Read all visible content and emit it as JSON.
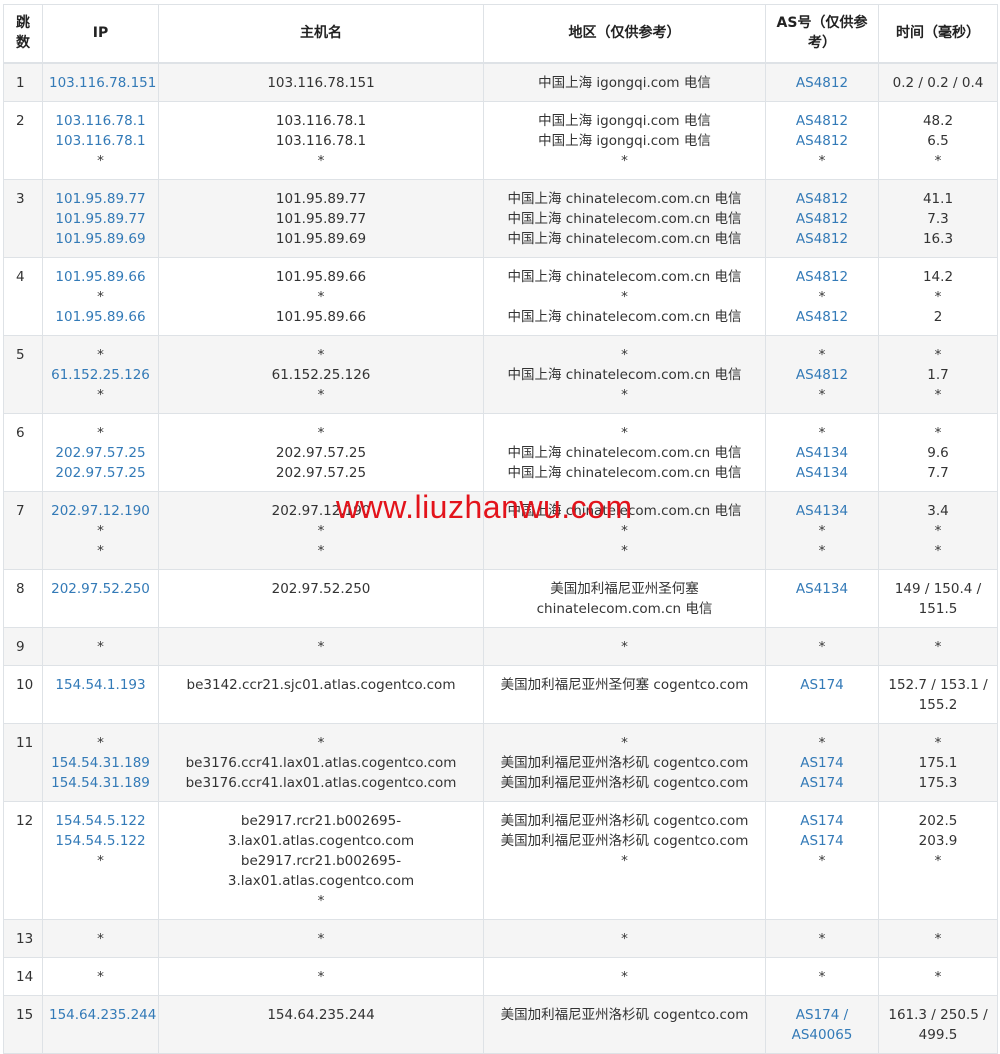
{
  "headers": {
    "hop": "跳数",
    "ip": "IP",
    "host": "主机名",
    "region": "地区（仅供参考）",
    "as": "AS号（仅供参考）",
    "time": "时间（毫秒）"
  },
  "rows": [
    {
      "hop": "1",
      "ips": [
        "103.116.78.151"
      ],
      "hosts": [
        "103.116.78.151"
      ],
      "regions": [
        "中国上海 igongqi.com 电信"
      ],
      "as": [
        "AS4812"
      ],
      "times": [
        "0.2 / 0.2 / 0.4"
      ]
    },
    {
      "hop": "2",
      "ips": [
        "103.116.78.1",
        "103.116.78.1",
        "*"
      ],
      "hosts": [
        "103.116.78.1",
        "103.116.78.1",
        "*"
      ],
      "regions": [
        "中国上海 igongqi.com 电信",
        "中国上海 igongqi.com 电信",
        "*"
      ],
      "as": [
        "AS4812",
        "AS4812",
        "*"
      ],
      "times": [
        "48.2",
        "6.5",
        "*"
      ]
    },
    {
      "hop": "3",
      "ips": [
        "101.95.89.77",
        "101.95.89.77",
        "101.95.89.69"
      ],
      "hosts": [
        "101.95.89.77",
        "101.95.89.77",
        "101.95.89.69"
      ],
      "regions": [
        "中国上海 chinatelecom.com.cn 电信",
        "中国上海 chinatelecom.com.cn 电信",
        "中国上海 chinatelecom.com.cn 电信"
      ],
      "as": [
        "AS4812",
        "AS4812",
        "AS4812"
      ],
      "times": [
        "41.1",
        "7.3",
        "16.3"
      ]
    },
    {
      "hop": "4",
      "ips": [
        "101.95.89.66",
        "*",
        "101.95.89.66"
      ],
      "hosts": [
        "101.95.89.66",
        "*",
        "101.95.89.66"
      ],
      "regions": [
        "中国上海 chinatelecom.com.cn 电信",
        "*",
        "中国上海 chinatelecom.com.cn 电信"
      ],
      "as": [
        "AS4812",
        "*",
        "AS4812"
      ],
      "times": [
        "14.2",
        "*",
        "2"
      ]
    },
    {
      "hop": "5",
      "ips": [
        "*",
        "61.152.25.126",
        "*"
      ],
      "hosts": [
        "*",
        "61.152.25.126",
        "*"
      ],
      "regions": [
        "*",
        "中国上海 chinatelecom.com.cn 电信",
        "*"
      ],
      "as": [
        "*",
        "AS4812",
        "*"
      ],
      "times": [
        "*",
        "1.7",
        "*"
      ]
    },
    {
      "hop": "6",
      "ips": [
        "*",
        "202.97.57.25",
        "202.97.57.25"
      ],
      "hosts": [
        "*",
        "202.97.57.25",
        "202.97.57.25"
      ],
      "regions": [
        "*",
        "中国上海 chinatelecom.com.cn 电信",
        "中国上海 chinatelecom.com.cn 电信"
      ],
      "as": [
        "*",
        "AS4134",
        "AS4134"
      ],
      "times": [
        "*",
        "9.6",
        "7.7"
      ]
    },
    {
      "hop": "7",
      "ips": [
        "202.97.12.190",
        "*",
        "*"
      ],
      "hosts": [
        "202.97.12.190",
        "*",
        "*"
      ],
      "regions": [
        "中国上海 chinatelecom.com.cn 电信",
        "*",
        "*"
      ],
      "as": [
        "AS4134",
        "*",
        "*"
      ],
      "times": [
        "3.4",
        "*",
        "*"
      ]
    },
    {
      "hop": "8",
      "ips": [
        "202.97.52.250"
      ],
      "hosts": [
        "202.97.52.250"
      ],
      "regions": [
        "美国加利福尼亚州圣何塞",
        "chinatelecom.com.cn 电信"
      ],
      "as": [
        "AS4134"
      ],
      "times": [
        "149 / 150.4 /",
        "151.5"
      ]
    },
    {
      "hop": "9",
      "ips": [
        "*"
      ],
      "hosts": [
        "*"
      ],
      "regions": [
        "*"
      ],
      "as": [
        "*"
      ],
      "times": [
        "*"
      ]
    },
    {
      "hop": "10",
      "ips": [
        "154.54.1.193"
      ],
      "hosts": [
        "be3142.ccr21.sjc01.atlas.cogentco.com"
      ],
      "regions": [
        "美国加利福尼亚州圣何塞 cogentco.com"
      ],
      "as": [
        "AS174"
      ],
      "times": [
        "152.7 / 153.1 /",
        "155.2"
      ]
    },
    {
      "hop": "11",
      "ips": [
        "*",
        "154.54.31.189",
        "154.54.31.189"
      ],
      "hosts": [
        "*",
        "be3176.ccr41.lax01.atlas.cogentco.com",
        "be3176.ccr41.lax01.atlas.cogentco.com"
      ],
      "regions": [
        "*",
        "美国加利福尼亚州洛杉矶 cogentco.com",
        "美国加利福尼亚州洛杉矶 cogentco.com"
      ],
      "as": [
        "*",
        "AS174",
        "AS174"
      ],
      "times": [
        "*",
        "175.1",
        "175.3"
      ]
    },
    {
      "hop": "12",
      "ips": [
        "154.54.5.122",
        "154.54.5.122",
        "*"
      ],
      "hosts": [
        "be2917.rcr21.b002695-",
        "3.lax01.atlas.cogentco.com",
        "be2917.rcr21.b002695-",
        "3.lax01.atlas.cogentco.com",
        "*"
      ],
      "regions": [
        "美国加利福尼亚州洛杉矶 cogentco.com",
        "美国加利福尼亚州洛杉矶 cogentco.com",
        "*"
      ],
      "as": [
        "AS174",
        "AS174",
        "*"
      ],
      "times": [
        "202.5",
        "203.9",
        "*"
      ]
    },
    {
      "hop": "13",
      "ips": [
        "*"
      ],
      "hosts": [
        "*"
      ],
      "regions": [
        "*"
      ],
      "as": [
        "*"
      ],
      "times": [
        "*"
      ]
    },
    {
      "hop": "14",
      "ips": [
        "*"
      ],
      "hosts": [
        "*"
      ],
      "regions": [
        "*"
      ],
      "as": [
        "*"
      ],
      "times": [
        "*"
      ]
    },
    {
      "hop": "15",
      "ips": [
        "154.64.235.244"
      ],
      "hosts": [
        "154.64.235.244"
      ],
      "regions": [
        "美国加利福尼亚州洛杉矶 cogentco.com"
      ],
      "as": [
        "AS174 /",
        "AS40065"
      ],
      "times": [
        "161.3 / 250.5 /",
        "499.5"
      ]
    }
  ],
  "watermark": "www.liuzhanwu.com",
  "colors": {
    "link": "#337ab7",
    "watermark": "#e3131b",
    "stripe": "#f5f5f5",
    "border": "#dee2e6"
  }
}
